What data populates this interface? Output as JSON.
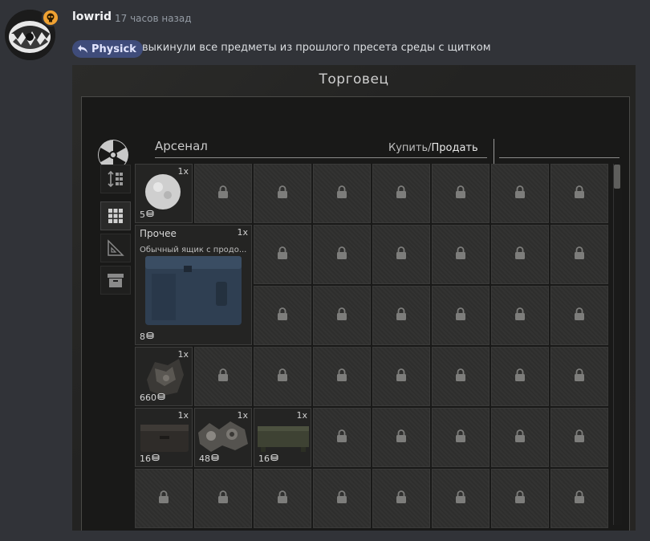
{
  "message": {
    "username": "lowrid",
    "timestamp": "17 часов назад",
    "reply_to": "Physick",
    "text": "выкинули все предметы из прошлого пресета среды с щитком"
  },
  "game": {
    "title": "Торговец",
    "trader_name": "Арсенал",
    "buy_label": "Купить",
    "separator": "/",
    "sell_label": "Продать",
    "items": {
      "snowball": {
        "qty": "1x",
        "count": "5"
      },
      "case": {
        "category": "Прочее",
        "qty": "1x",
        "description": "Обычный ящик с продо...",
        "count": "8"
      },
      "scrap": {
        "qty": "1x",
        "count": "660"
      },
      "box": {
        "qty": "1x",
        "count": "16"
      },
      "parts": {
        "qty": "1x",
        "count": "48"
      },
      "crate": {
        "qty": "1x",
        "count": "16"
      }
    }
  },
  "icons": {
    "avatar_badge": "skull-icon",
    "reply": "reply-arrow-icon",
    "trader": "radiation-icon",
    "sort": "sort-icon",
    "grid_view": "grid-icon",
    "ruler": "triangle-ruler-icon",
    "archive": "archive-icon",
    "locked_slot": "lock-icon",
    "currency": "coin-stack-icon"
  },
  "colors": {
    "badge": "#f0a232",
    "reply_pill": "#3f4c7a"
  }
}
